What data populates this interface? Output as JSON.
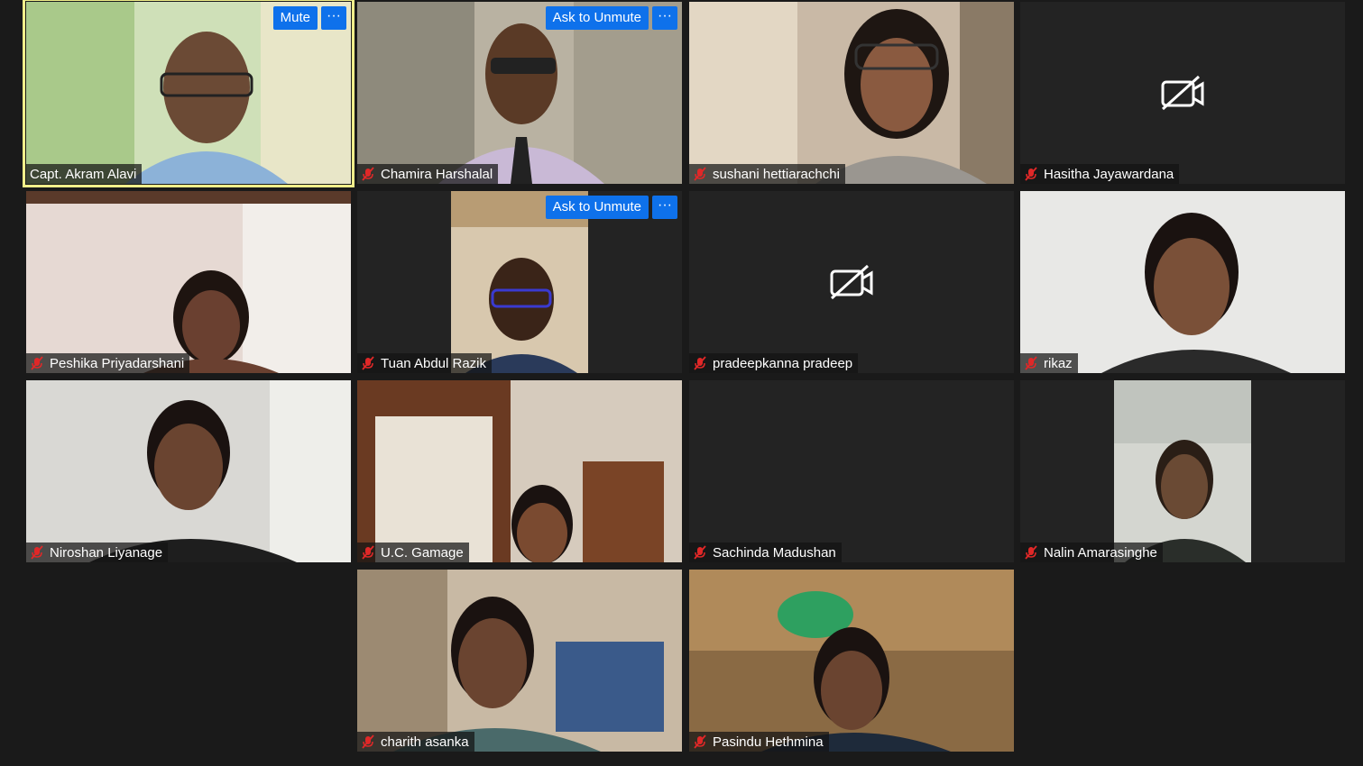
{
  "controls": {
    "mute_label": "Mute",
    "ask_to_unmute_label": "Ask to Unmute",
    "more_label": "···"
  },
  "participants": [
    {
      "name": "Capt. Akram Alavi"
    },
    {
      "name": "Chamira Harshalal"
    },
    {
      "name": "sushani hettiarachchi"
    },
    {
      "name": "Hasitha Jayawardana"
    },
    {
      "name": "Peshika Priyadarshani"
    },
    {
      "name": "Tuan Abdul Razik"
    },
    {
      "name": "pradeepkanna pradeep"
    },
    {
      "name": "rikaz"
    },
    {
      "name": "Niroshan Liyanage"
    },
    {
      "name": "U.C. Gamage"
    },
    {
      "name": "Sachinda Madushan"
    },
    {
      "name": "Nalin Amarasinghe"
    },
    {
      "name": "charith asanka"
    },
    {
      "name": "Pasindu Hethmina"
    }
  ],
  "colors": {
    "background": "#1a1a1a",
    "tile_empty": "#232323",
    "button_blue": "#0e71eb",
    "active_speaker_border": "#f0ee8a",
    "muted_icon": "#e02828"
  },
  "icons": {
    "muted": "microphone-muted-icon",
    "camera_off": "camera-off-icon",
    "more": "more-options-icon"
  }
}
